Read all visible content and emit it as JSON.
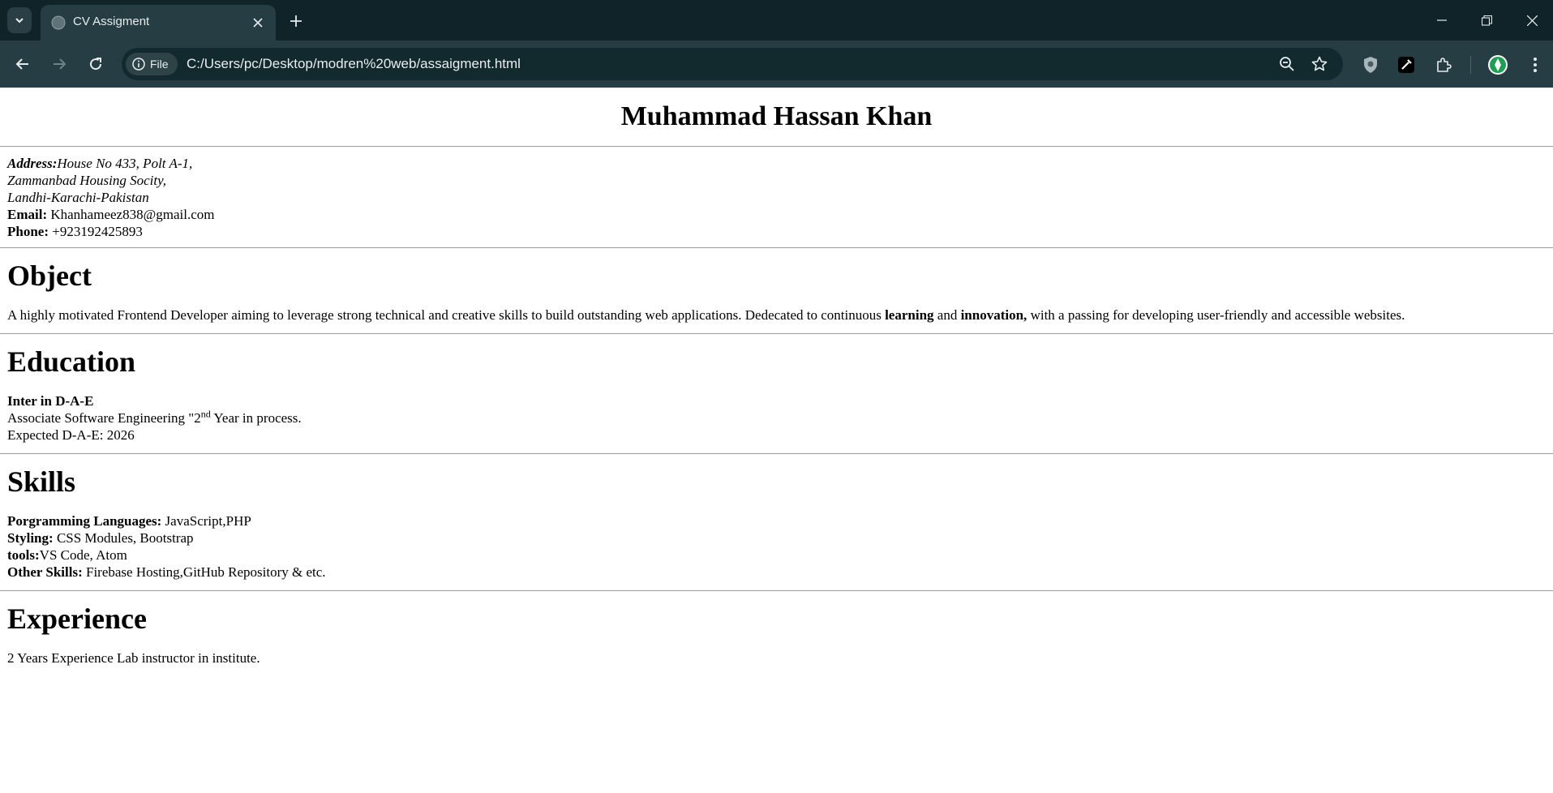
{
  "browser": {
    "tab_title": "CV Assigment",
    "chip_label": "File",
    "url": "C:/Users/pc/Desktop/modren%20web/assaigment.html",
    "icons": [
      "tab-list-icon",
      "globe-icon",
      "close-icon",
      "plus-icon",
      "minimize-icon",
      "restore-icon",
      "window-close-icon",
      "back-icon",
      "forward-icon",
      "reload-icon",
      "info-icon",
      "zoom-out-icon",
      "star-icon",
      "shield-extension-icon",
      "eyedropper-extension-icon",
      "puzzle-extensions-icon",
      "profile-avatar-icon",
      "menu-kebab-icon"
    ]
  },
  "cv": {
    "name": "Muhammad Hassan Khan",
    "contact": {
      "address_label": "Address:",
      "address_line1": "House No 433, Polt A-1,",
      "address_line2": "Zammanbad Housing Socity,",
      "address_line3": "Landhi-Karachi-Pakistan",
      "email_label": "Email:",
      "email": " Khanhameez838@gmail.com",
      "phone_label": "Phone:",
      "phone": " +923192425893"
    },
    "object": {
      "heading": "Object",
      "text_part1": "A highly motivated Frontend Developer aiming to leverage strong technical and creative skills to build outstanding web applications. Dedecated to continuous ",
      "bold1": "learning",
      "text_part2": " and ",
      "bold2": "innovation,",
      "text_part3": " with a passing for developing user-friendly and accessible websites."
    },
    "education": {
      "heading": "Education",
      "degree": "Inter in D-A-E",
      "line1_part1": "Associate Software Engineering \"2",
      "line1_sup": "nd",
      "line1_part2": " Year in process.",
      "line2": "Expected D-A-E: 2026"
    },
    "skills": {
      "heading": "Skills",
      "items": [
        {
          "label": "Porgramming Languages:",
          "value": " JavaScript,PHP"
        },
        {
          "label": "Styling:",
          "value": " CSS Modules, Bootstrap"
        },
        {
          "label": "tools:",
          "value": "VS Code, Atom"
        },
        {
          "label": "Other Skills:",
          "value": " Firebase Hosting,GitHub Repository & etc."
        }
      ]
    },
    "experience": {
      "heading": "Experience",
      "text": "2 Years Experience Lab instructor in institute."
    }
  }
}
